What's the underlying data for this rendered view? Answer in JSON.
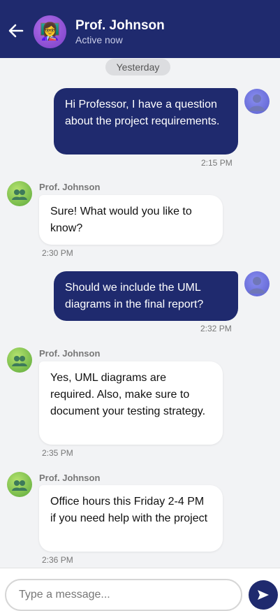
{
  "header": {
    "name": "Prof. Johnson",
    "status": "Active now",
    "avatar_glyph": "👩‍🏫"
  },
  "conversation": {
    "date_label": "Yesterday",
    "messages": [
      {
        "from": "me",
        "text": "Hi Professor, I have a question about the project requirements.",
        "time": "2:15 PM"
      },
      {
        "from": "prof",
        "sender": "Prof. Johnson",
        "text": "Sure! What would you like to know?",
        "time": "2:30 PM"
      },
      {
        "from": "me",
        "text": "Should we include the UML diagrams in the final report?",
        "time": "2:32 PM"
      },
      {
        "from": "prof",
        "sender": "Prof. Johnson",
        "text": "Yes, UML diagrams are required. Also, make sure to document your testing strategy.",
        "time": "2:35 PM"
      },
      {
        "from": "prof",
        "sender": "Prof. Johnson",
        "text": "Office hours this Friday 2-4 PM if you need help with the project",
        "time": "2:36 PM"
      }
    ]
  },
  "composer": {
    "placeholder": "Type a message..."
  },
  "colors": {
    "primary": "#1f2a6e",
    "background": "#f2f3f5"
  }
}
